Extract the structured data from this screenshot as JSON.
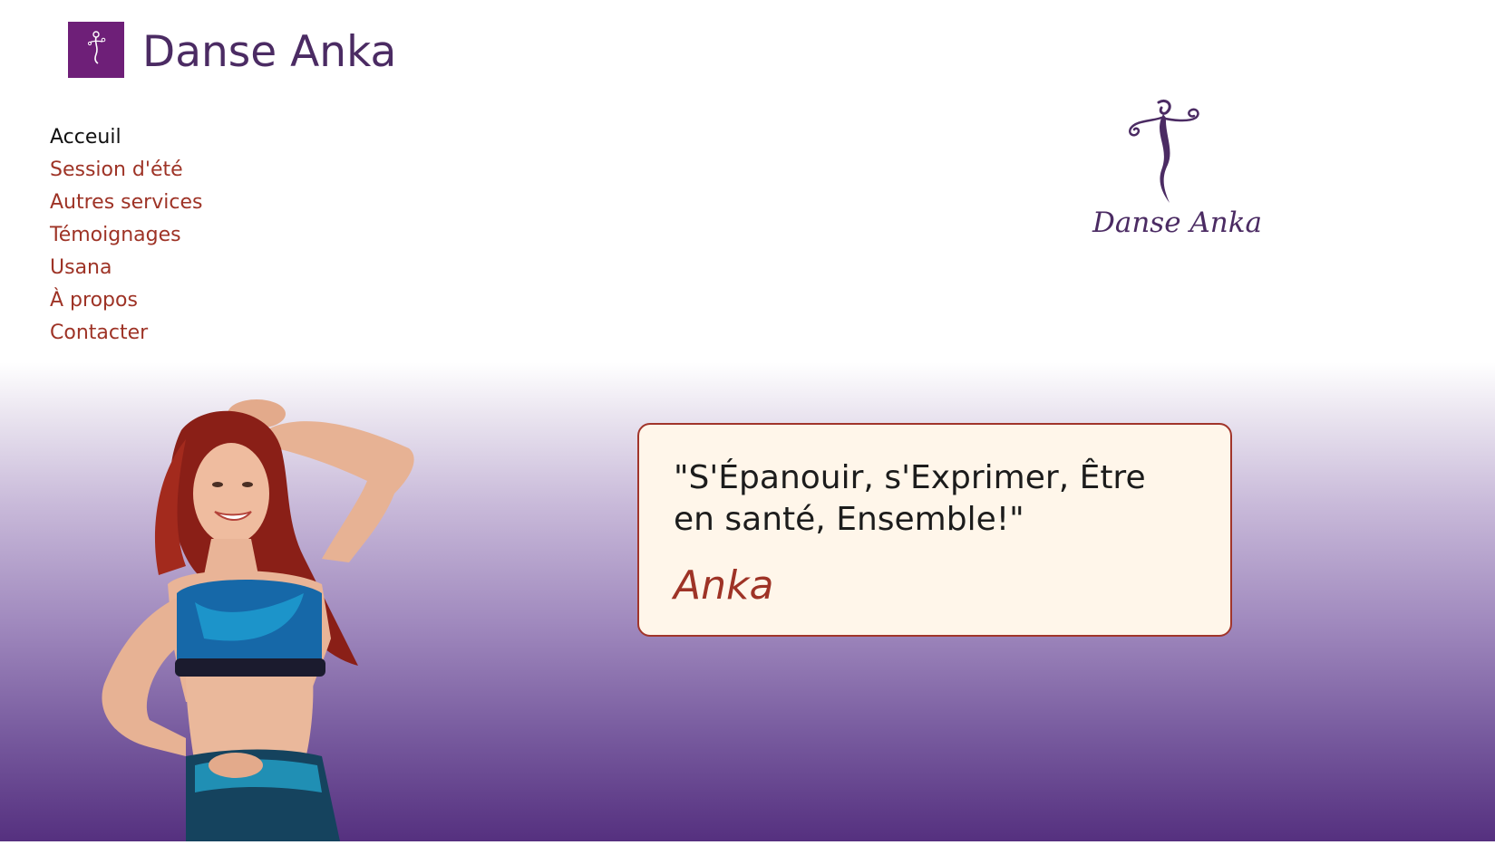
{
  "brand": {
    "title": "Danse Anka",
    "icon": "danse-anka-logo-icon",
    "color": "#4b2b63"
  },
  "nav": {
    "items": [
      {
        "label": "Acceuil",
        "active": true
      },
      {
        "label": "Session d'été"
      },
      {
        "label": "Autres services"
      },
      {
        "label": "Témoignages"
      },
      {
        "label": "Usana"
      },
      {
        "label": "À propos"
      },
      {
        "label": "Contacter"
      }
    ],
    "link_color": "#9e3326",
    "active_color": "#111111"
  },
  "logo": {
    "text": "Danse Anka",
    "color": "#4b2b63"
  },
  "hero": {
    "quote": "\"S'Épanouir, s'Exprimer, Être en santé, Ensemble!\"",
    "author": "Anka",
    "gradient_bottom": "#55307f",
    "card_background": "#fff6ea",
    "card_border": "#a1352b"
  }
}
